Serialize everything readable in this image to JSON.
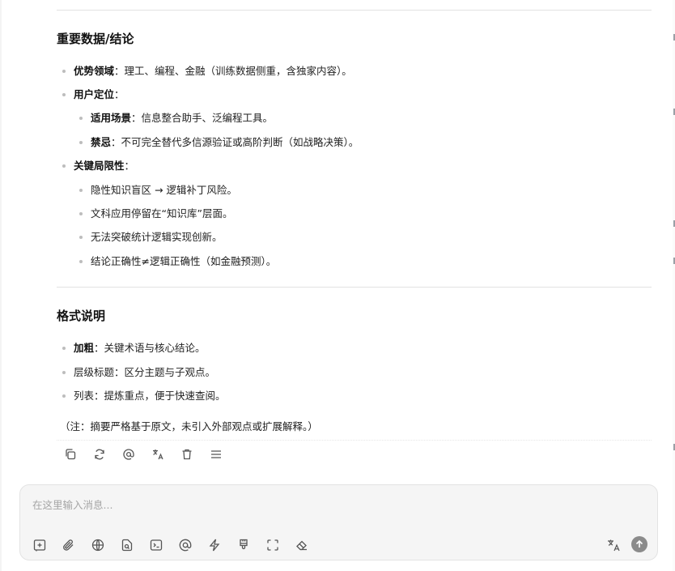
{
  "sections": {
    "key_data": {
      "title": "重要数据/结论",
      "items": [
        {
          "bold": "优势领域",
          "text": "：理工、编程、金融（训练数据侧重，含独家内容）。"
        },
        {
          "bold": "用户定位",
          "text": "："
        },
        {
          "bold": "适用场景",
          "text": "：信息整合助手、泛编程工具。"
        },
        {
          "bold": "禁忌",
          "text": "：不可完全替代多信源验证或高阶判断（如战略决策）。"
        },
        {
          "bold": "关键局限性",
          "text": "："
        },
        {
          "bold": "",
          "text": "隐性知识盲区 → 逻辑补丁风险。"
        },
        {
          "bold": "",
          "text": "文科应用停留在“知识库”层面。"
        },
        {
          "bold": "",
          "text": "无法突破统计逻辑实现创新。"
        },
        {
          "bold": "",
          "text": "结论正确性≠逻辑正确性（如金融预测）。"
        }
      ]
    },
    "format": {
      "title": "格式说明",
      "items": [
        {
          "bold": "加粗",
          "text": "：关键术语与核心结论。"
        },
        {
          "bold": "",
          "text": "层级标题：区分主题与子观点。"
        },
        {
          "bold": "",
          "text": "列表：提炼重点，便于快速查阅。"
        }
      ],
      "note": "（注：摘要严格基于原文，未引入外部观点或扩展解释。）"
    }
  },
  "message_actions": [
    "copy-icon",
    "regenerate-icon",
    "mention-icon",
    "translate-icon",
    "delete-icon",
    "menu-icon"
  ],
  "composer": {
    "placeholder": "在这里输入消息...",
    "tools": [
      "attach-add-icon",
      "paperclip-icon",
      "globe-icon",
      "file-search-icon",
      "terminal-icon",
      "at-icon",
      "lightning-icon",
      "brush-icon",
      "screenshot-icon",
      "eraser-icon"
    ]
  },
  "colors": {
    "send_button": "#8b8b8b",
    "composer_bg": "#f5f5f5",
    "bullet": "#bdbdbd"
  }
}
